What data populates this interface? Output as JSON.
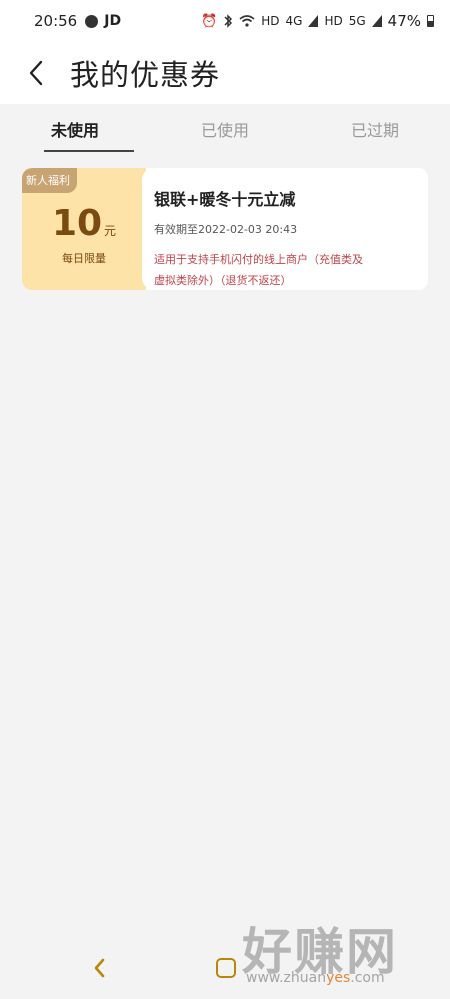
{
  "status_bar": {
    "time": "20:56",
    "carrier": "JD",
    "network_hd1": "HD",
    "network_4g": "4G",
    "network_hd2": "HD",
    "network_5g": "5G",
    "battery": "47%"
  },
  "header": {
    "title": "我的优惠券"
  },
  "tabs": [
    {
      "label": "未使用",
      "active": true
    },
    {
      "label": "已使用",
      "active": false
    },
    {
      "label": "已过期",
      "active": false
    }
  ],
  "coupon": {
    "tag": "新人福利",
    "amount": "10",
    "unit": "元",
    "limit": "每日限量",
    "title": "银联+暖冬十元立减",
    "expiry": "有效期至2022-02-03 20:43",
    "note": "适用于支持手机闪付的线上商户（充值类及虚拟类除外）（退货不返还）"
  },
  "watermark": {
    "big": "好赚网",
    "url_part1": "www.zhuan",
    "url_highlight": "yes",
    "url_part2": ".com"
  },
  "colors": {
    "coupon_left_bg": "#fde3a8",
    "coupon_tag_bg": "#c8a472",
    "coupon_amount": "#7a4a10",
    "note_red": "#c0444a",
    "nav_accent": "#b8860b"
  }
}
